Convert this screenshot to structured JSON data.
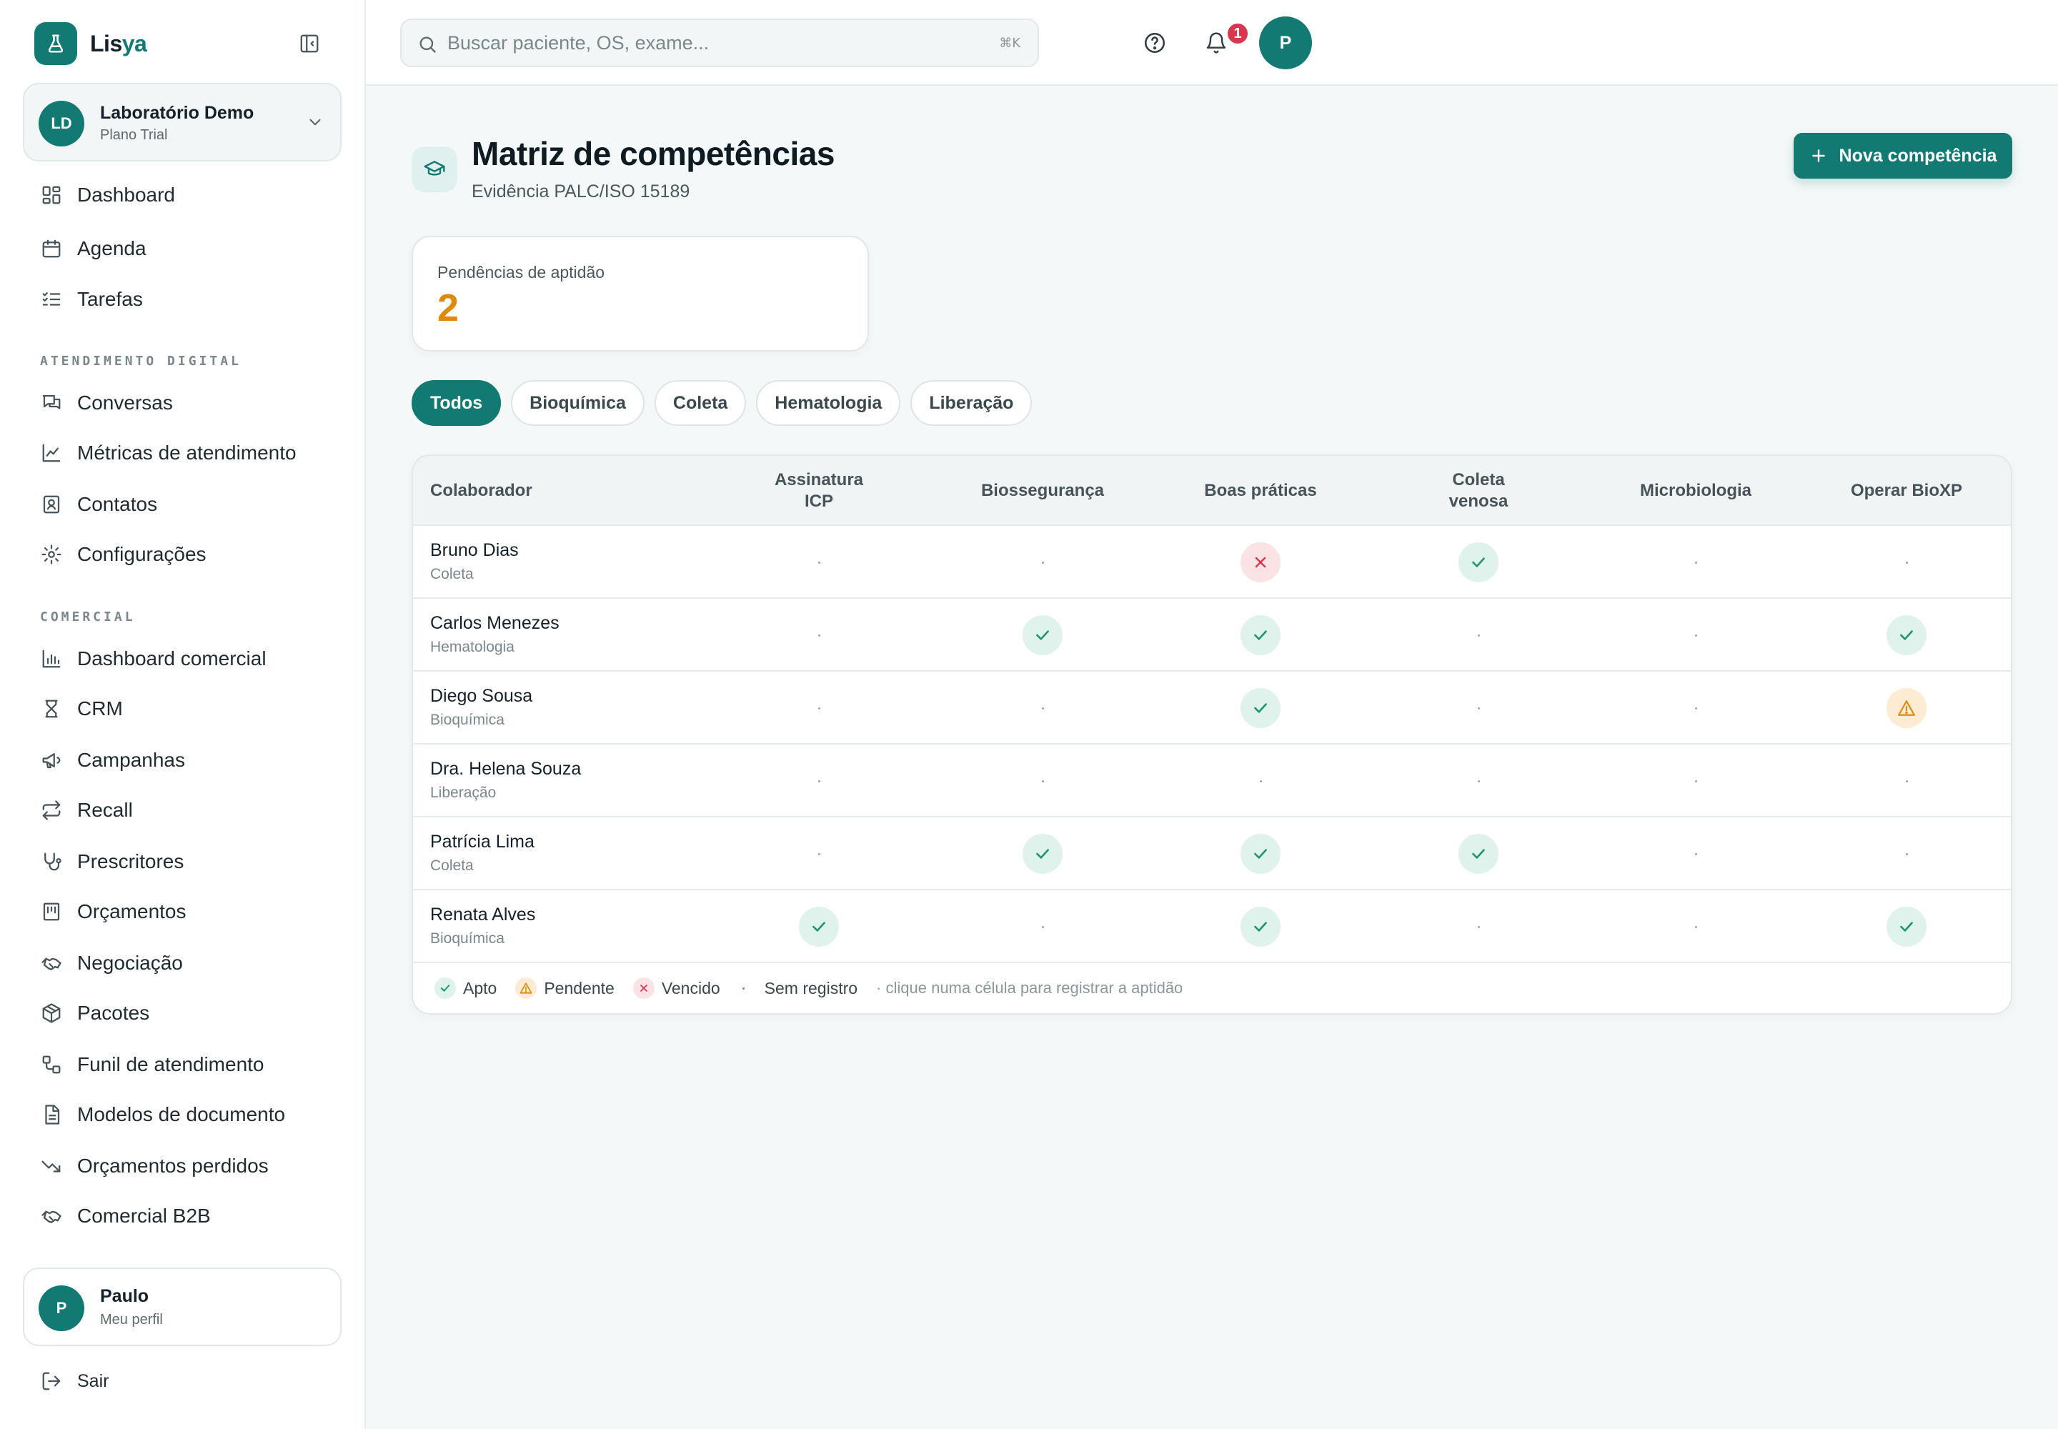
{
  "brand": {
    "name_prefix": "Lis",
    "name_suffix": "ya"
  },
  "org": {
    "initials": "LD",
    "name": "Laboratório Demo",
    "plan": "Plano Trial"
  },
  "nav": {
    "main": [
      {
        "label": "Dashboard",
        "icon": "dashboard-icon"
      },
      {
        "label": "Agenda",
        "icon": "calendar-icon"
      },
      {
        "label": "Tarefas",
        "icon": "tasks-icon"
      }
    ],
    "section_digital": "ATENDIMENTO DIGITAL",
    "digital": [
      {
        "label": "Conversas",
        "icon": "chat-icon"
      },
      {
        "label": "Métricas de atendimento",
        "icon": "line-chart-icon"
      },
      {
        "label": "Contatos",
        "icon": "contacts-icon"
      },
      {
        "label": "Configurações",
        "icon": "gear-icon"
      }
    ],
    "section_comercial": "COMERCIAL",
    "comercial": [
      {
        "label": "Dashboard comercial",
        "icon": "bar-chart-icon"
      },
      {
        "label": "CRM",
        "icon": "crm-icon"
      },
      {
        "label": "Campanhas",
        "icon": "megaphone-icon"
      },
      {
        "label": "Recall",
        "icon": "repeat-icon"
      },
      {
        "label": "Prescritores",
        "icon": "stethoscope-icon"
      },
      {
        "label": "Orçamentos",
        "icon": "receipt-icon"
      },
      {
        "label": "Negociação",
        "icon": "handshake-icon"
      },
      {
        "label": "Pacotes",
        "icon": "package-icon"
      },
      {
        "label": "Funil de atendimento",
        "icon": "workflow-icon"
      },
      {
        "label": "Modelos de documento",
        "icon": "document-icon"
      },
      {
        "label": "Orçamentos perdidos",
        "icon": "trending-down-icon"
      },
      {
        "label": "Comercial B2B",
        "icon": "handshake-icon"
      }
    ]
  },
  "user": {
    "initial": "P",
    "name": "Paulo",
    "subtitle": "Meu perfil",
    "logout": "Sair"
  },
  "search": {
    "placeholder": "Buscar paciente, OS, exame...",
    "shortcut": "⌘K"
  },
  "notifications": {
    "count": "1"
  },
  "page": {
    "title": "Matriz de competências",
    "subtitle": "Evidência PALC/ISO 15189",
    "new_button": "Nova competência"
  },
  "stats": {
    "label": "Pendências de aptidão",
    "value": "2"
  },
  "filters": [
    "Todos",
    "Bioquímica",
    "Coleta",
    "Hematologia",
    "Liberação"
  ],
  "active_filter": "Todos",
  "table": {
    "first_column": "Colaborador",
    "columns": [
      {
        "line1": "Assinatura",
        "line2": "ICP"
      },
      {
        "line1": "Biossegurança",
        "line2": ""
      },
      {
        "line1": "Boas práticas",
        "line2": ""
      },
      {
        "line1": "Coleta",
        "line2": "venosa"
      },
      {
        "line1": "Microbiologia",
        "line2": ""
      },
      {
        "line1": "Operar BioXP",
        "line2": ""
      }
    ],
    "rows": [
      {
        "name": "Bruno Dias",
        "dept": "Coleta",
        "cells": [
          "none",
          "none",
          "vencido",
          "apto",
          "none",
          "none"
        ]
      },
      {
        "name": "Carlos Menezes",
        "dept": "Hematologia",
        "cells": [
          "none",
          "apto",
          "apto",
          "none",
          "none",
          "apto"
        ]
      },
      {
        "name": "Diego Sousa",
        "dept": "Bioquímica",
        "cells": [
          "none",
          "none",
          "apto",
          "none",
          "none",
          "pendente"
        ]
      },
      {
        "name": "Dra. Helena Souza",
        "dept": "Liberação",
        "cells": [
          "none",
          "none",
          "none",
          "none",
          "none",
          "none"
        ]
      },
      {
        "name": "Patrícia Lima",
        "dept": "Coleta",
        "cells": [
          "none",
          "apto",
          "apto",
          "apto",
          "none",
          "none"
        ]
      },
      {
        "name": "Renata Alves",
        "dept": "Bioquímica",
        "cells": [
          "apto",
          "none",
          "apto",
          "none",
          "none",
          "apto"
        ]
      }
    ]
  },
  "legend": {
    "apto": "Apto",
    "pendente": "Pendente",
    "vencido": "Vencido",
    "none": "Sem registro",
    "hint": "· clique numa célula para registrar a aptidão"
  },
  "colors": {
    "primary": "#127a72",
    "pending": "#df8a0e",
    "expired": "#d9364d",
    "ok": "#1d9670"
  }
}
